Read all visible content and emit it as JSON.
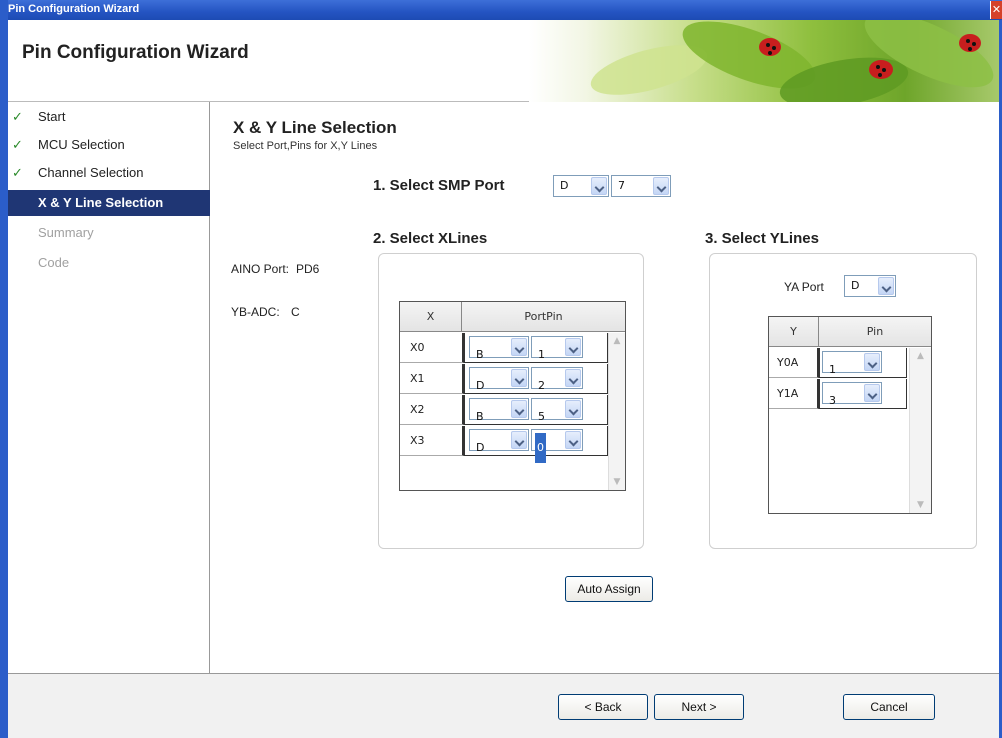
{
  "window": {
    "title": "Pin Configuration Wizard",
    "close_glyph": "✕"
  },
  "header": {
    "title": "Pin Configuration Wizard"
  },
  "sidebar": {
    "items": [
      {
        "label": "Start",
        "state": "done",
        "check": "✓"
      },
      {
        "label": "MCU Selection",
        "state": "done",
        "check": "✓"
      },
      {
        "label": "Channel Selection",
        "state": "done",
        "check": "✓"
      },
      {
        "label": "X & Y Line Selection",
        "state": "active",
        "check": ""
      },
      {
        "label": "Summary",
        "state": "disabled",
        "check": ""
      },
      {
        "label": "Code",
        "state": "disabled",
        "check": ""
      }
    ]
  },
  "main": {
    "title": "X & Y Line Selection",
    "subtitle": "Select Port,Pins for X,Y Lines",
    "smp": {
      "label": "1. Select SMP Port",
      "port": "D",
      "pin": "7"
    },
    "info": {
      "aino_label": "AINO Port:",
      "aino_value": "PD6",
      "ybadc_label": "YB-ADC:",
      "ybadc_value": "C"
    },
    "xlines": {
      "label": "2. Select XLines",
      "col_x": "X",
      "col_portpin": "PortPin",
      "rows": [
        {
          "x": "X0",
          "port": "B",
          "pin": "1"
        },
        {
          "x": "X1",
          "port": "D",
          "pin": "2"
        },
        {
          "x": "X2",
          "port": "B",
          "pin": "5"
        },
        {
          "x": "X3",
          "port": "D",
          "pin": "0"
        }
      ]
    },
    "ylines": {
      "label": "3. Select YLines",
      "ya_port_label": "YA Port",
      "ya_port_value": "D",
      "col_y": "Y",
      "col_pin": "Pin",
      "rows": [
        {
          "y": "Y0A",
          "pin": "1"
        },
        {
          "y": "Y1A",
          "pin": "3"
        }
      ]
    },
    "auto_assign_label": "Auto Assign"
  },
  "footer": {
    "back_label": "< Back",
    "next_label": "Next >",
    "cancel_label": "Cancel"
  },
  "icons": {
    "check": "check-icon",
    "dropdown": "chevron-down-icon",
    "close": "close-icon"
  },
  "colors": {
    "titlebar": "#2454c2",
    "active_nav": "#1f3674",
    "check_green": "#2a8a2a",
    "selection": "#316ac5"
  }
}
